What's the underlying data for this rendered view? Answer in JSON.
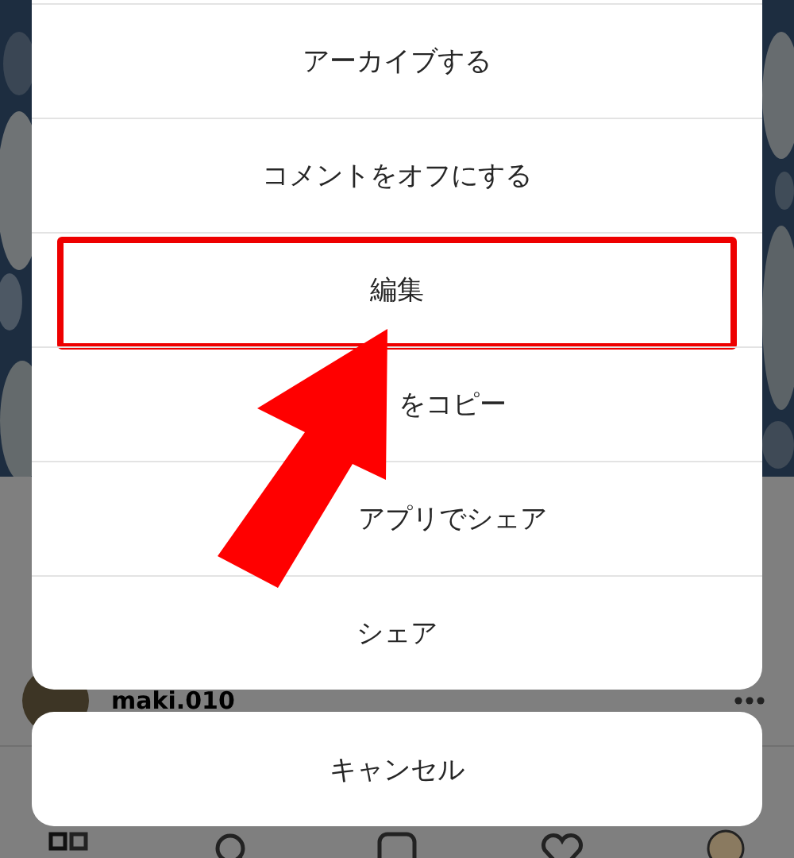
{
  "menu": {
    "items": [
      {
        "label": "アーカイブする",
        "kind": "full",
        "highlighted": false
      },
      {
        "label": "コメントをオフにする",
        "kind": "full",
        "highlighted": false
      },
      {
        "label": "編集",
        "kind": "full",
        "highlighted": true
      },
      {
        "label": "をコピー",
        "kind": "covered",
        "highlighted": false
      },
      {
        "label": "アプリでシェア",
        "kind": "covered",
        "highlighted": false
      },
      {
        "label": "シェア",
        "kind": "full",
        "highlighted": false
      }
    ],
    "cancel": "キャンセル"
  },
  "post": {
    "username": "maki.010"
  }
}
